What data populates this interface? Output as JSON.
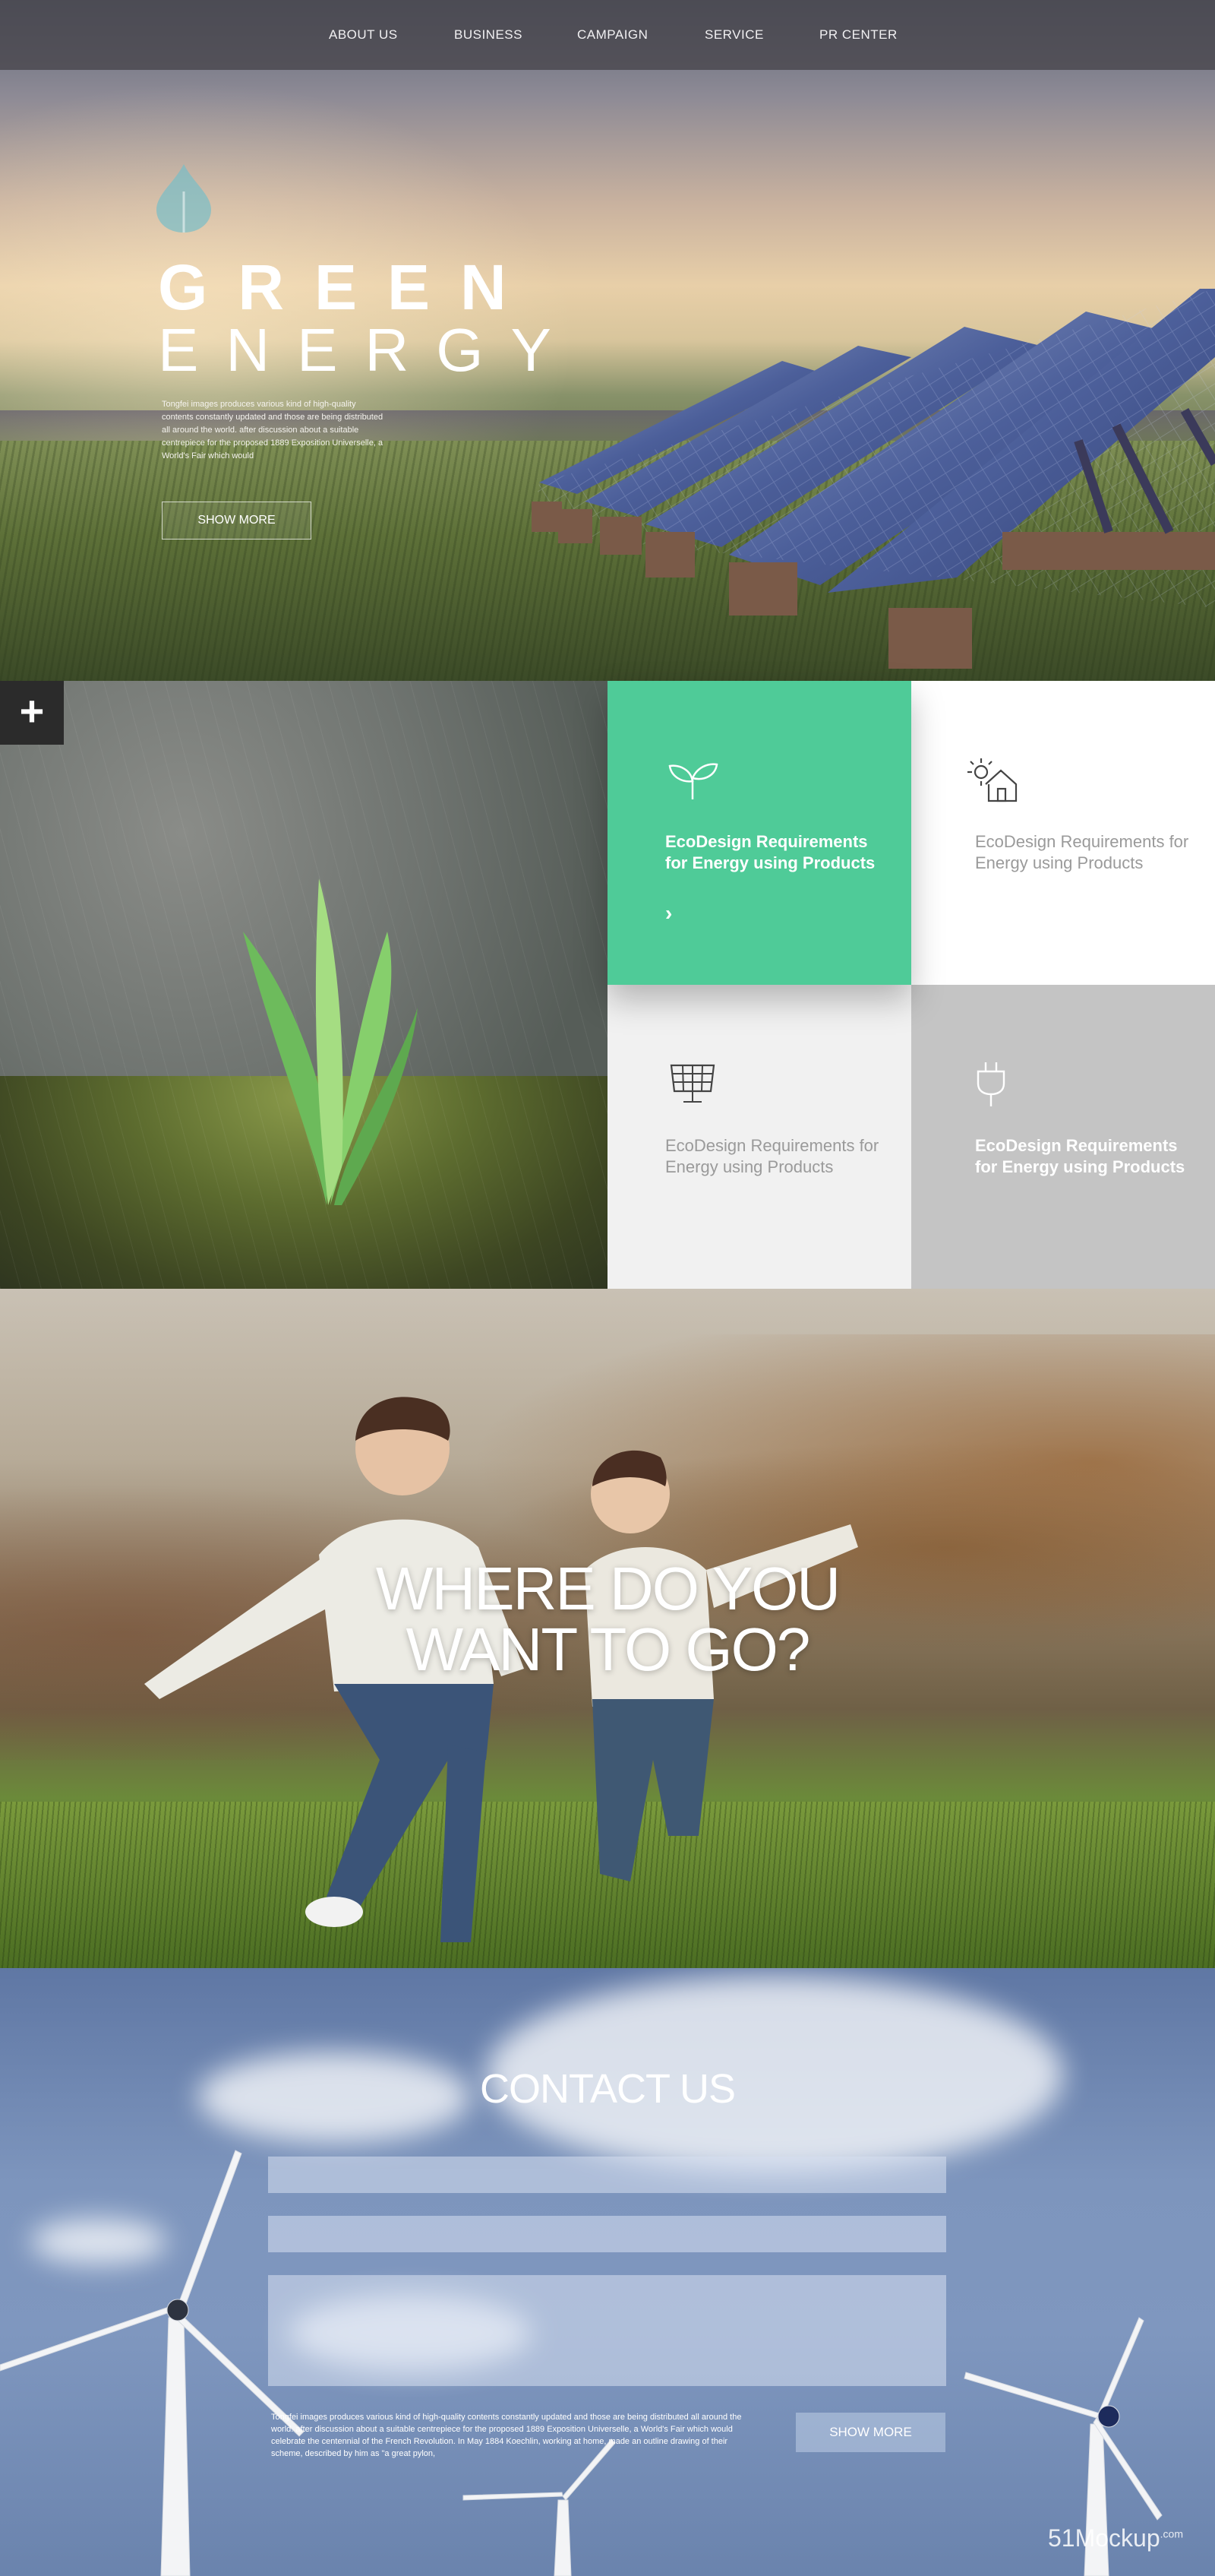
{
  "nav": {
    "items": [
      {
        "label": "ABOUT US"
      },
      {
        "label": "BUSINESS"
      },
      {
        "label": "CAMPAIGN"
      },
      {
        "label": "SERVICE"
      },
      {
        "label": "PR CENTER"
      }
    ]
  },
  "hero": {
    "title_line1": "GREEN",
    "title_line2": "ENERGY",
    "description": "Tongfei images produces various kind of high-quality contents constantly updated and those are being distributed all around the world. after discussion about a suitable centrepiece for the proposed 1889 Exposition Universelle, a World's Fair which would",
    "button_label": "SHOW MORE"
  },
  "feature": {
    "plus_label": "+",
    "cards": [
      {
        "text": "EcoDesign Requirements for Energy using Products",
        "icon": "sprout-icon",
        "bg": "#4fcb98",
        "color": "#ffffff"
      },
      {
        "text": "EcoDesign Requirements for Energy using Products",
        "icon": "solar-house-icon",
        "bg": "#ffffff",
        "color": "#9a9a9a"
      },
      {
        "text": "EcoDesign Requirements for Energy using Products",
        "icon": "solar-panel-icon",
        "bg": "#f1f1f1",
        "color": "#9a9a9a"
      },
      {
        "text": "EcoDesign Requirements for Energy using Products",
        "icon": "plug-icon",
        "bg": "#c4c4c4",
        "color": "#ffffff"
      }
    ],
    "arrow": "›"
  },
  "kids": {
    "title_line1": "WHERE DO YOU",
    "title_line2": "WANT TO GO?"
  },
  "contact": {
    "title": "CONTACT US",
    "description": "Tongfei images produces various kind of high-quality contents constantly updated and those are being distributed all around the world. after discussion about a suitable centrepiece for the proposed 1889 Exposition Universelle, a World's Fair which would celebrate the centennial of the French Revolution. In May 1884 Koechlin, working at home, made an outline drawing of their scheme, described by him as \"a great pylon,",
    "button_label": "SHOW MORE",
    "watermark": "51Mockup",
    "watermark_sup": ".com"
  },
  "colors": {
    "accent_green": "#4fcb98",
    "nav_bg": "#46444a"
  }
}
